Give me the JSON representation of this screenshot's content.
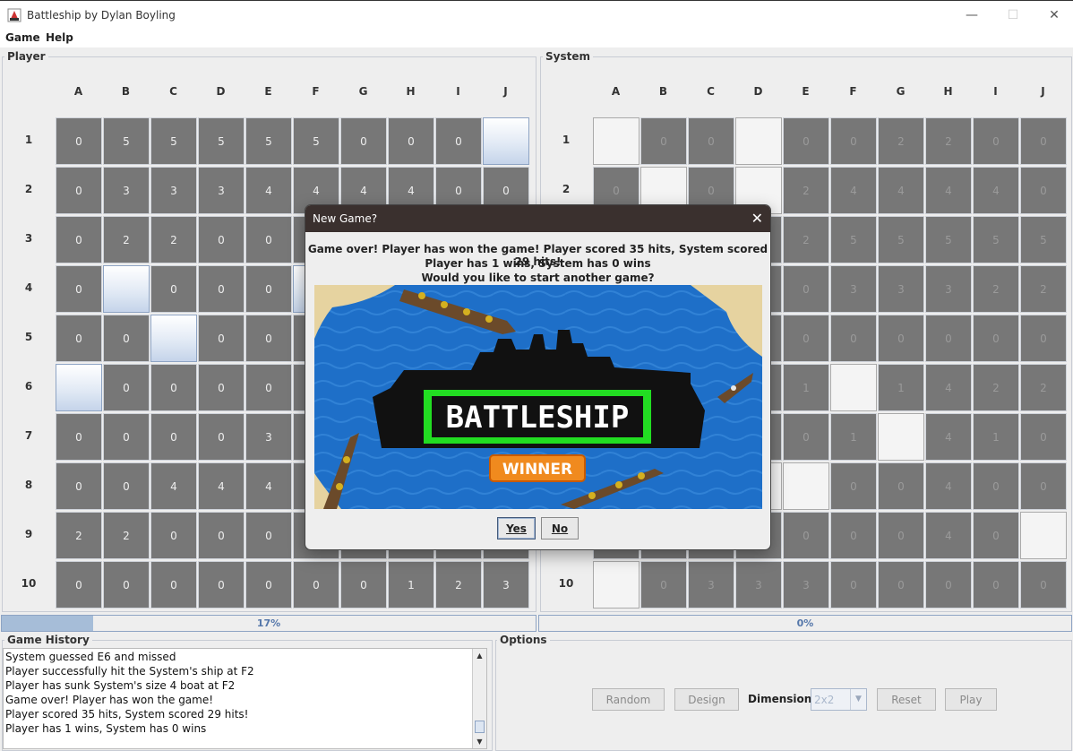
{
  "window": {
    "title": "Battleship by Dylan Boyling",
    "minimize_glyph": "—",
    "maximize_glyph": "☐",
    "close_glyph": "✕"
  },
  "menu": {
    "game": "Game",
    "help": "Help"
  },
  "columns": [
    "A",
    "B",
    "C",
    "D",
    "E",
    "F",
    "G",
    "H",
    "I",
    "J"
  ],
  "rows": [
    "1",
    "2",
    "3",
    "4",
    "5",
    "6",
    "7",
    "8",
    "9",
    "10"
  ],
  "player": {
    "label": "Player",
    "grid": [
      [
        "0",
        "5",
        "5",
        "5",
        "5",
        "5",
        "0",
        "0",
        "0",
        "#B"
      ],
      [
        "0",
        "3",
        "3",
        "3",
        "4",
        "4",
        "4",
        "4",
        "0",
        "0"
      ],
      [
        "0",
        "2",
        "2",
        "0",
        "0",
        "",
        "",
        "",
        "",
        ""
      ],
      [
        "0",
        "#B",
        "0",
        "0",
        "0",
        "#B",
        "",
        "",
        "",
        ""
      ],
      [
        "0",
        "0",
        "#B",
        "0",
        "0",
        "",
        "",
        "",
        "",
        ""
      ],
      [
        "#B",
        "0",
        "0",
        "0",
        "0",
        "",
        "",
        "",
        "",
        ""
      ],
      [
        "0",
        "0",
        "0",
        "0",
        "3",
        "",
        "",
        "",
        "",
        ""
      ],
      [
        "0",
        "0",
        "4",
        "4",
        "4",
        "",
        "",
        "",
        "",
        ""
      ],
      [
        "2",
        "2",
        "0",
        "0",
        "0",
        "",
        "",
        "",
        "",
        ""
      ],
      [
        "0",
        "0",
        "0",
        "0",
        "0",
        "0",
        "0",
        "1",
        "2",
        "3"
      ]
    ],
    "progress_text": "17%",
    "progress_value": 0.17
  },
  "system": {
    "label": "System",
    "grid": [
      [
        "#W",
        "0",
        "0",
        "#W",
        "0",
        "0",
        "2",
        "2",
        "0",
        "0"
      ],
      [
        "0",
        "#W",
        "0",
        "#W",
        "2",
        "4",
        "4",
        "4",
        "4",
        "0"
      ],
      [
        "",
        "",
        "",
        "",
        "2",
        "5",
        "5",
        "5",
        "5",
        "5"
      ],
      [
        "",
        "",
        "",
        "",
        "0",
        "3",
        "3",
        "3",
        "2",
        "2"
      ],
      [
        "",
        "",
        "",
        "",
        "0",
        "0",
        "0",
        "0",
        "0",
        "0"
      ],
      [
        "",
        "",
        "",
        "",
        "1",
        "#W",
        "1",
        "4",
        "2",
        "2"
      ],
      [
        "",
        "",
        "",
        "",
        "0",
        "1",
        "#W",
        "4",
        "1",
        "0"
      ],
      [
        "",
        "",
        "",
        "#W",
        "#W",
        "0",
        "0",
        "4",
        "0",
        "0"
      ],
      [
        "",
        "",
        "",
        "",
        "0",
        "0",
        "0",
        "4",
        "0",
        "#W"
      ],
      [
        "#W",
        "0",
        "3",
        "3",
        "3",
        "0",
        "0",
        "0",
        "0",
        "0"
      ]
    ],
    "progress_text": "0%",
    "progress_value": 0
  },
  "history": {
    "label": "Game History",
    "lines": [
      "System guessed E6 and missed",
      "Player successfully hit the System's ship at F2",
      "Player has sunk System's size 4 boat at F2",
      "Game over! Player has won the game!",
      "Player scored 35 hits, System scored 29 hits!",
      "Player has 1 wins, System has 0 wins"
    ]
  },
  "options": {
    "label": "Options",
    "random": "Random",
    "design": "Design",
    "dimensions_label": "Dimensions:",
    "dimensions_value": "2x2",
    "reset": "Reset",
    "play": "Play"
  },
  "dialog": {
    "title": "New Game?",
    "line1": "Game over! Player has won the game! Player scored 35 hits, System scored 29 hits!",
    "line2": "Player has 1 wins, System has 0 wins",
    "line3": "Would you like to start another game?",
    "banner_title": "BATTLESHIP",
    "banner_badge": "WINNER",
    "yes": "Yes",
    "no": "No"
  },
  "colors": {
    "cell_gray": "#777777",
    "hit_blue": "#c5d4ea",
    "dialog_title_bg": "#3a302e",
    "banner_green": "#22dd22",
    "banner_orange": "#f08a1e",
    "sea_blue": "#1e6fc8"
  }
}
